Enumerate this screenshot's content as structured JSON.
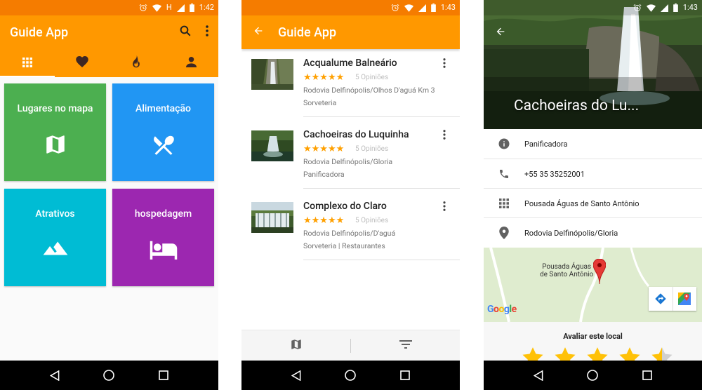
{
  "status": {
    "time_1": "1:42",
    "time_2": "1:43",
    "time_3": "1:43",
    "network": "H"
  },
  "app": {
    "title": "Guide App"
  },
  "home": {
    "tabs": [
      {
        "icon": "grid-icon"
      },
      {
        "icon": "heart-icon"
      },
      {
        "icon": "flame-icon"
      },
      {
        "icon": "person-icon"
      }
    ],
    "tiles": [
      {
        "label": "Lugares no mapa",
        "icon": "map-icon",
        "color": "#4caf50"
      },
      {
        "label": "Alimentação",
        "icon": "cutlery-icon",
        "color": "#2196f3"
      },
      {
        "label": "Atrativos",
        "icon": "mountains-icon",
        "color": "#00bcd4"
      },
      {
        "label": "hospedagem",
        "icon": "bed-icon",
        "color": "#9c27b0"
      }
    ]
  },
  "list": {
    "items": [
      {
        "title": "Acqualume Balneário",
        "rating": 4.5,
        "stars": "★★★★★",
        "opinions": "5 Opiniões",
        "address": "Rodovia Delfinópolis/Olhos D'aguá Km 3",
        "category": "Sorveteria"
      },
      {
        "title": "Cachoeiras do Luquinha",
        "rating": 4.5,
        "stars": "★★★★★",
        "opinions": "5 Opiniões",
        "address": "Rodovia Delfinópolis/Gloria",
        "category": "Panificadora"
      },
      {
        "title": "Complexo do Claro",
        "rating": 4.5,
        "stars": "★★★★★",
        "opinions": "5 Opiniões",
        "address": "Rodovia Delfinópolis/D'aguá",
        "category": "Sorveteria | Restaurantes"
      }
    ]
  },
  "detail": {
    "title": "Cachoeiras do Lu...",
    "rows": [
      {
        "icon": "info-icon",
        "text": "Panificadora"
      },
      {
        "icon": "phone-icon",
        "text": "+55 35 35252001"
      },
      {
        "icon": "grid-icon",
        "text": "Pousada Águas de Santo Antônio"
      },
      {
        "icon": "location-pin-icon",
        "text": "Rodovia Delfinópolis/Gloria"
      }
    ],
    "map_label": "Pousada Águas de Santo Antônio",
    "map_label_1": "Pousada Águas",
    "map_label_2": "de Santo Antônio",
    "map_provider": "Google",
    "rate_label": "Avaliar este local",
    "user_rating": 4.5
  },
  "colors": {
    "primary": "#ff9800",
    "star": "#ffa000"
  }
}
